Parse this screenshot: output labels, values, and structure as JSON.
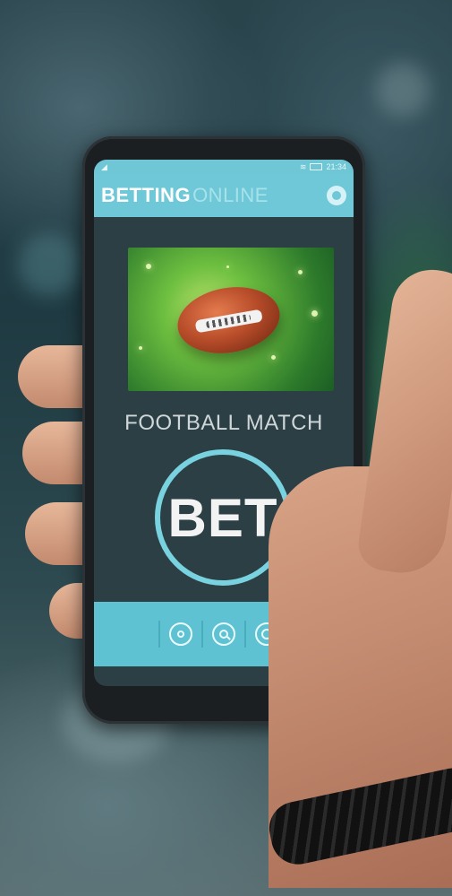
{
  "scene": {
    "background": "blurred sports screen and hand holding a phone"
  },
  "app": {
    "title_bold": "BETTING",
    "title_light": "ONLINE",
    "status": {
      "time": "21:34"
    },
    "section_title": "FOOTBALL MATCH",
    "bet_label": "BET",
    "bottom_nav": [
      {
        "icon": "home-circle-icon"
      },
      {
        "icon": "search-icon"
      },
      {
        "icon": "target-icon"
      }
    ],
    "colors": {
      "accent": "#6ec8d7",
      "screen_bg": "#2c3f45",
      "bet_ring": "#78d2df"
    }
  }
}
